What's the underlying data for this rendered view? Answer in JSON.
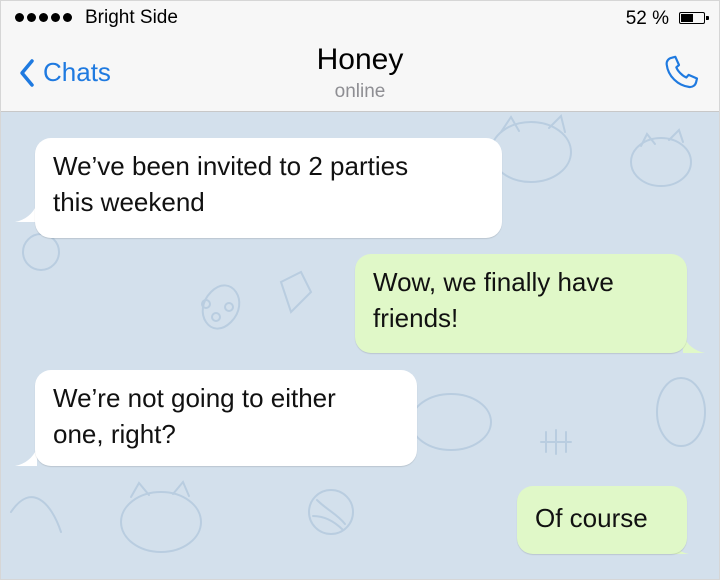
{
  "status_bar": {
    "carrier": "Bright Side",
    "battery_text": "52 %",
    "battery_level": 0.52
  },
  "nav": {
    "back_label": "Chats",
    "contact_name": "Honey",
    "contact_status": "online"
  },
  "messages": [
    {
      "direction": "incoming",
      "text": "We’ve been invited to 2 parties\nthis weekend"
    },
    {
      "direction": "outgoing",
      "text": "Wow, we finally have\nfriends!"
    },
    {
      "direction": "incoming",
      "text": "We’re not going to either\none, right?"
    },
    {
      "direction": "outgoing",
      "text": "Of course"
    }
  ],
  "colors": {
    "accent": "#1f7ae0",
    "incoming_bubble": "#ffffff",
    "outgoing_bubble": "#e0f8c8",
    "chat_background": "#d3e0ec"
  },
  "icons": {
    "back": "chevron-left-icon",
    "call": "phone-icon"
  }
}
